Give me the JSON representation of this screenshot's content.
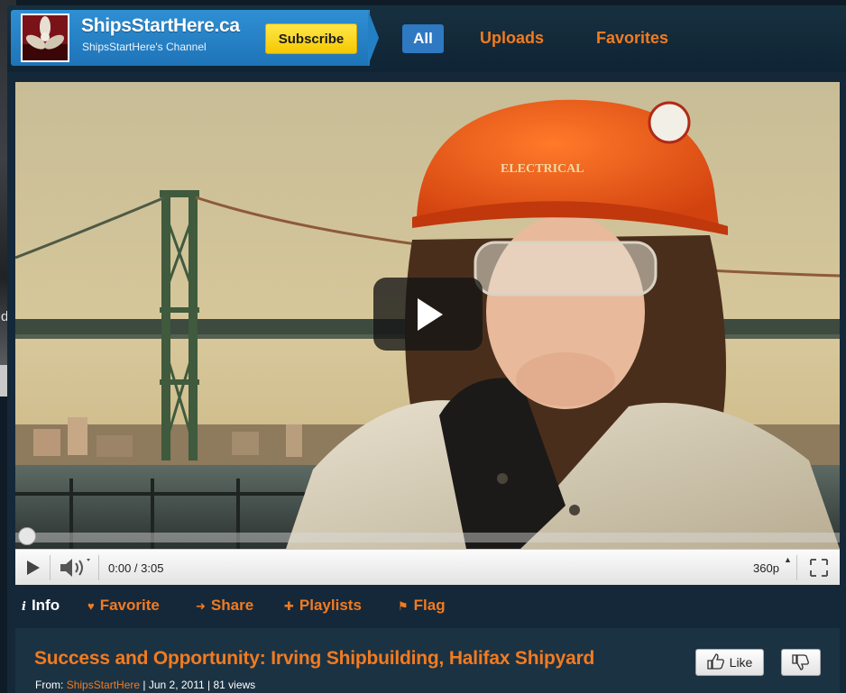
{
  "background_page": {
    "visible_letter": "d"
  },
  "channel": {
    "name": "ShipsStartHere.ca",
    "subtitle": "ShipsStartHere's Channel",
    "subscribe_label": "Subscribe",
    "avatar_icon": "propeller-logo"
  },
  "nav_tabs": [
    {
      "label": "All",
      "active": true
    },
    {
      "label": "Uploads",
      "active": false
    },
    {
      "label": "Favorites",
      "active": false
    }
  ],
  "player": {
    "time": "0:00 / 3:05",
    "quality": "360p",
    "progress_fraction": 0,
    "play_icon": "play-icon",
    "volume_icon": "volume-icon",
    "fullscreen_icon": "fullscreen-icon",
    "hardhat_text": "ELECTRICAL"
  },
  "action_tabs": {
    "info": "Info",
    "favorite": "Favorite",
    "share": "Share",
    "playlists": "Playlists",
    "flag": "Flag"
  },
  "video_info": {
    "title": "Success and Opportunity: Irving Shipbuilding, Halifax Shipyard",
    "from_label": "From:",
    "uploader": "ShipsStartHere",
    "date": "| Jun 2, 2011",
    "views": "| 81 views",
    "like_label": "Like"
  },
  "colors": {
    "accent_orange": "#f27b20",
    "header_blue": "#2380c4",
    "subscribe_yellow": "#f5c800",
    "panel_dark": "#1b3243"
  }
}
